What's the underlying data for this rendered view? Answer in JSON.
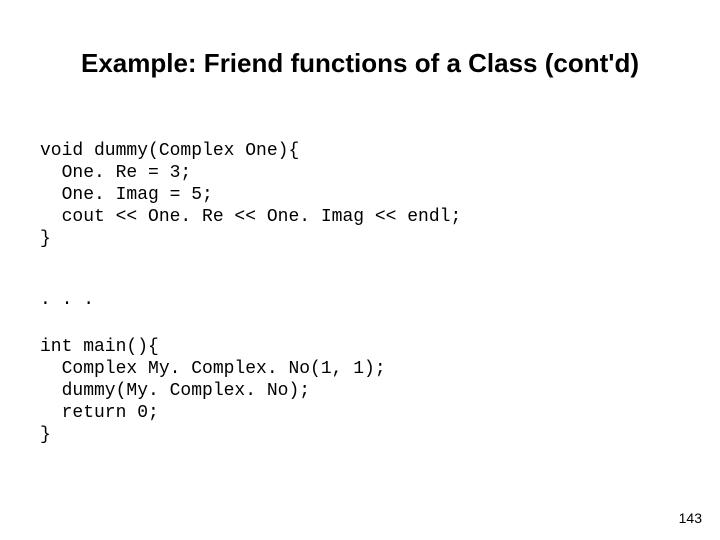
{
  "title": "Example: Friend functions of a Class (cont'd)",
  "code": {
    "block1": "void dummy(Complex One){\n  One. Re = 3;\n  One. Imag = 5;\n  cout << One. Re << One. Imag << endl;\n}",
    "ellipsis": ". . .",
    "block2": "int main(){\n  Complex My. Complex. No(1, 1);\n  dummy(My. Complex. No);\n  return 0;\n}"
  },
  "page_number": "143"
}
